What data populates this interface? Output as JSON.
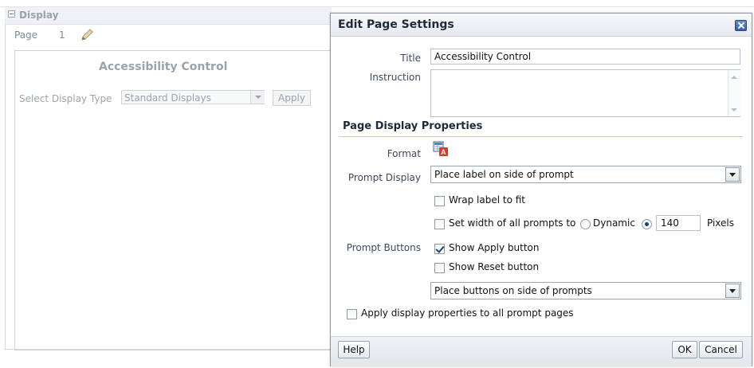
{
  "background": {
    "section_title": "Display",
    "page_label": "Page",
    "page_number": "1",
    "prompt_title": "Accessibility Control",
    "select_label": "Select Display Type",
    "select_value": "Standard Displays",
    "apply_label": "Apply"
  },
  "dialog": {
    "title": "Edit Page Settings",
    "title_label": "Title",
    "title_value": "Accessibility Control",
    "instruction_label": "Instruction",
    "instruction_value": "",
    "section_heading": "Page Display Properties",
    "format_label": "Format",
    "prompt_display_label": "Prompt Display",
    "prompt_display_value": "Place label on side of prompt",
    "wrap_label": "Wrap label to fit",
    "wrap_checked": false,
    "set_width_label": "Set width of all prompts to",
    "set_width_checked": false,
    "dynamic_label": "Dynamic",
    "width_value": "140",
    "pixels_label": "Pixels",
    "prompt_buttons_label": "Prompt Buttons",
    "show_apply_label": "Show Apply button",
    "show_apply_checked": true,
    "show_reset_label": "Show Reset button",
    "show_reset_checked": false,
    "buttons_position_value": "Place buttons on side of prompts",
    "apply_all_label": "Apply display properties to all prompt pages",
    "apply_all_checked": false,
    "help_label": "Help",
    "ok_label": "OK",
    "cancel_label": "Cancel"
  },
  "colors": {
    "dialog_border": "#8d98a8",
    "title_text": "#1e2a38",
    "check_mark": "#1f3f7a",
    "heading_rule": "#d8cfa8",
    "muted_text": "#9aa3ab"
  }
}
